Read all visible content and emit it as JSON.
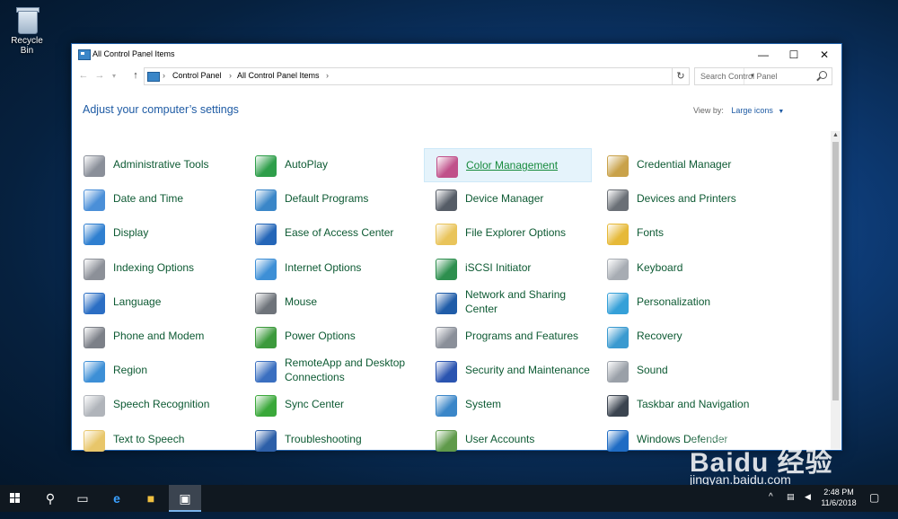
{
  "desktop": {
    "recycle_bin_label": "Recycle Bin"
  },
  "window": {
    "title": "All Control Panel Items",
    "controls": {
      "minimize": "—",
      "maximize": "☐",
      "close": "✕"
    }
  },
  "address": {
    "crumbs": [
      "Control Panel",
      "All Control Panel Items"
    ],
    "search_placeholder": "Search Control Panel"
  },
  "header": {
    "title": "Adjust your computer’s settings",
    "view_by_label": "View by:",
    "view_by_value": "Large icons"
  },
  "items": [
    {
      "label": "Administrative Tools",
      "icon": "admin-tools-icon",
      "color": "#8a8f99"
    },
    {
      "label": "AutoPlay",
      "icon": "autoplay-icon",
      "color": "#2e9e4a"
    },
    {
      "label": "Color Management",
      "icon": "color-management-icon",
      "color": "#c0508a"
    },
    {
      "label": "Credential Manager",
      "icon": "credential-manager-icon",
      "color": "#c9a24a"
    },
    {
      "label": "Date and Time",
      "icon": "date-time-icon",
      "color": "#4a8fd8"
    },
    {
      "label": "Default Programs",
      "icon": "default-programs-icon",
      "color": "#3a86c8"
    },
    {
      "label": "Device Manager",
      "icon": "device-manager-icon",
      "color": "#555c66"
    },
    {
      "label": "Devices and Printers",
      "icon": "devices-printers-icon",
      "color": "#6a6f76"
    },
    {
      "label": "Display",
      "icon": "display-icon",
      "color": "#2f7fd0"
    },
    {
      "label": "Ease of Access Center",
      "icon": "ease-of-access-icon",
      "color": "#2466b8"
    },
    {
      "label": "File Explorer Options",
      "icon": "file-explorer-options-icon",
      "color": "#e9c45a"
    },
    {
      "label": "Fonts",
      "icon": "fonts-icon",
      "color": "#e6b938"
    },
    {
      "label": "Indexing Options",
      "icon": "indexing-options-icon",
      "color": "#8c9098"
    },
    {
      "label": "Internet Options",
      "icon": "internet-options-icon",
      "color": "#3d8fd6"
    },
    {
      "label": "iSCSI Initiator",
      "icon": "iscsi-initiator-icon",
      "color": "#2d8f4e"
    },
    {
      "label": "Keyboard",
      "icon": "keyboard-icon",
      "color": "#a7acb3"
    },
    {
      "label": "Language",
      "icon": "language-icon",
      "color": "#2b6ec4"
    },
    {
      "label": "Mouse",
      "icon": "mouse-icon",
      "color": "#6e737a"
    },
    {
      "label": "Network and Sharing Center",
      "icon": "network-sharing-icon",
      "color": "#1f5ca8"
    },
    {
      "label": "Personalization",
      "icon": "personalization-icon",
      "color": "#35a0d8"
    },
    {
      "label": "Phone and Modem",
      "icon": "phone-modem-icon",
      "color": "#7c8088"
    },
    {
      "label": "Power Options",
      "icon": "power-options-icon",
      "color": "#3c9a3c"
    },
    {
      "label": "Programs and Features",
      "icon": "programs-features-icon",
      "color": "#8a8f99"
    },
    {
      "label": "Recovery",
      "icon": "recovery-icon",
      "color": "#3a9ad0"
    },
    {
      "label": "Region",
      "icon": "region-icon",
      "color": "#3d8fd6"
    },
    {
      "label": "RemoteApp and Desktop Connections",
      "icon": "remoteapp-icon",
      "color": "#3a6fc0"
    },
    {
      "label": "Security and Maintenance",
      "icon": "security-maintenance-icon",
      "color": "#2a54b0"
    },
    {
      "label": "Sound",
      "icon": "sound-icon",
      "color": "#9aa0a8"
    },
    {
      "label": "Speech Recognition",
      "icon": "speech-recognition-icon",
      "color": "#b0b4ba"
    },
    {
      "label": "Sync Center",
      "icon": "sync-center-icon",
      "color": "#3aa83a"
    },
    {
      "label": "System",
      "icon": "system-icon",
      "color": "#3a86c8"
    },
    {
      "label": "Taskbar and Navigation",
      "icon": "taskbar-navigation-icon",
      "color": "#3b4450"
    },
    {
      "label": "Text to Speech",
      "icon": "text-to-speech-icon",
      "color": "#e8c66a"
    },
    {
      "label": "Troubleshooting",
      "icon": "troubleshooting-icon",
      "color": "#2d5fa8"
    },
    {
      "label": "User Accounts",
      "icon": "user-accounts-icon",
      "color": "#5f9a4a"
    },
    {
      "label": "Windows Defender",
      "icon": "windows-defender-icon",
      "color": "#1f6cc4"
    }
  ],
  "selected_item": "Color Management",
  "watermark": {
    "text": "Activate Windows",
    "brand": "Baidu 经验",
    "site": "jingyan.baidu.com"
  },
  "taskbar": {
    "time": "2:48 PM",
    "date": "11/6/2018"
  }
}
